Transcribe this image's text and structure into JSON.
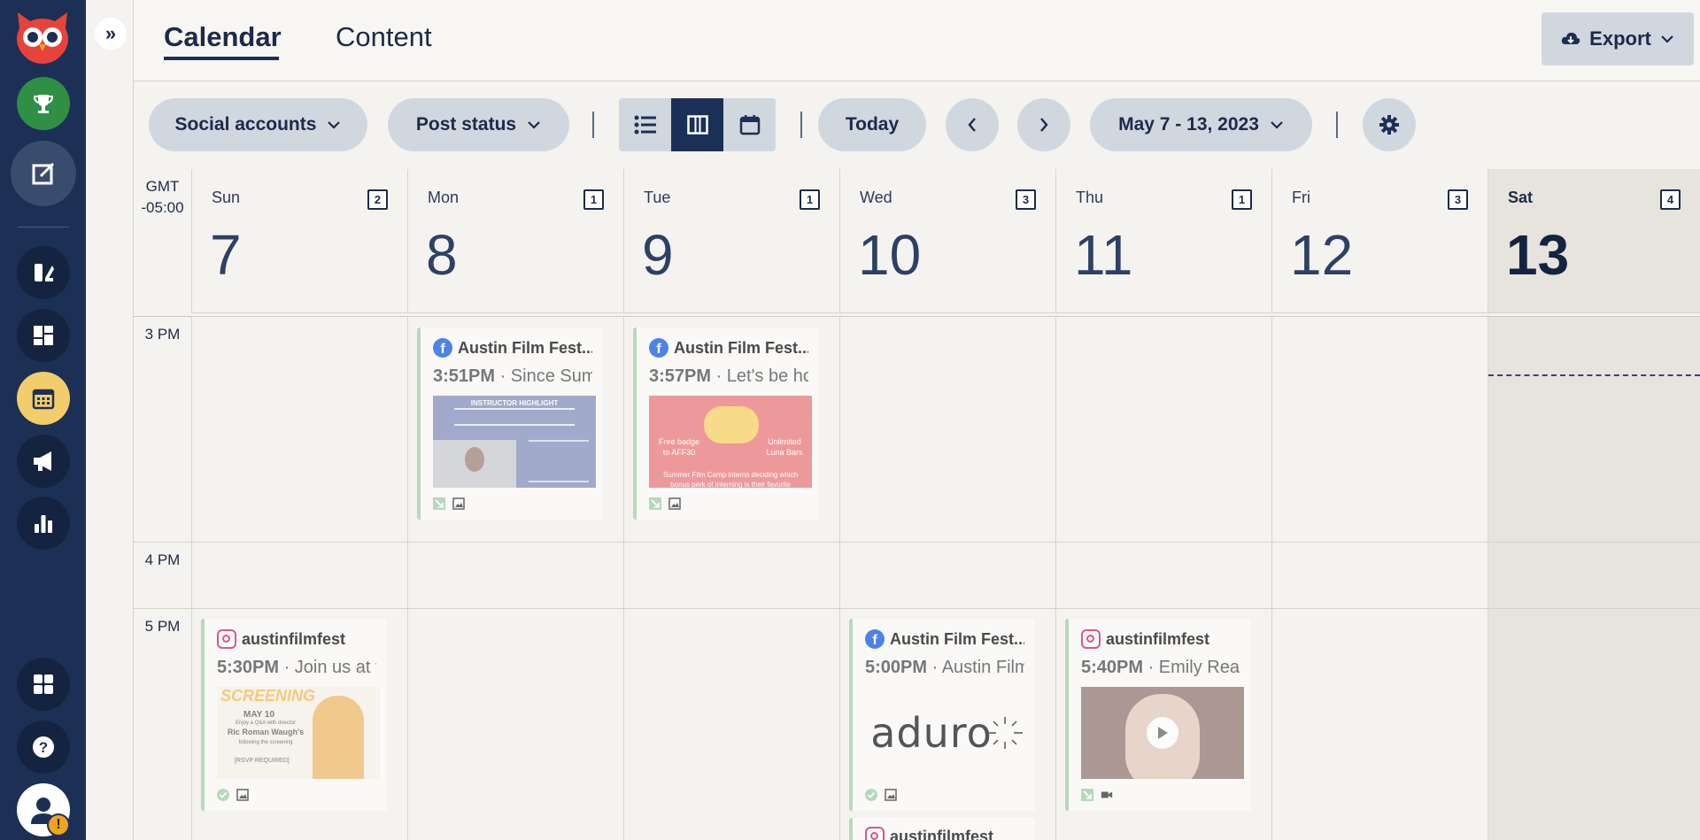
{
  "nav": {
    "items": [
      "owl-logo",
      "trophy-icon",
      "compose-icon",
      "content-icon",
      "dashboard-icon",
      "planner-icon",
      "megaphone-icon",
      "analytics-icon",
      "apps-icon",
      "help-icon",
      "profile-icon"
    ],
    "warning_badge": "!"
  },
  "tabs": {
    "calendar": "Calendar",
    "content": "Content"
  },
  "export": {
    "label": "Export"
  },
  "toolbar": {
    "social_accounts": "Social accounts",
    "post_status": "Post status",
    "today": "Today",
    "date_range": "May 7 - 13, 2023",
    "active_view": "week"
  },
  "calendar": {
    "timezone_line1": "GMT",
    "timezone_line2": "-05:00",
    "days": [
      {
        "name": "Sun",
        "num": "7",
        "count": "2"
      },
      {
        "name": "Mon",
        "num": "8",
        "count": "1"
      },
      {
        "name": "Tue",
        "num": "9",
        "count": "1"
      },
      {
        "name": "Wed",
        "num": "10",
        "count": "3"
      },
      {
        "name": "Thu",
        "num": "11",
        "count": "1"
      },
      {
        "name": "Fri",
        "num": "12",
        "count": "3"
      },
      {
        "name": "Sat",
        "num": "13",
        "count": "4"
      }
    ],
    "times": [
      "3 PM",
      "4 PM",
      "5 PM"
    ]
  },
  "posts": [
    {
      "account": "Austin Film Fest...",
      "time": "3:51PM",
      "text": "· Since Summ",
      "network": "facebook",
      "media_title": "INSTRUCTOR HIGHLIGHT"
    },
    {
      "account": "Austin Film Fest...",
      "time": "3:57PM",
      "text": "· Let's be ho",
      "network": "facebook",
      "media_left": "Free badge to AFF30",
      "media_right": "Unlimited Luna Bars",
      "media_bottom": "Summer Film Camp interns deciding which bonus perk of interning is their favorite"
    },
    {
      "account": "austinfilmfest",
      "time": "5:30PM",
      "text": "· Join us at t",
      "network": "instagram",
      "media_title": "SCREENING",
      "media_date": "MAY 10",
      "media_sub": "Enjoy a Q&A with director",
      "media_name": "Ric Roman Waugh's",
      "media_sub2": "following the screening",
      "media_rsvp": "[RSVP REQUIRED]"
    },
    {
      "account": "Austin Film Fest...",
      "time": "5:00PM",
      "text": "· Austin Film",
      "network": "facebook",
      "media_logo": "aduro"
    },
    {
      "account": "austinfilmfest",
      "time": "5:40PM",
      "text": "· Emily Reas",
      "network": "instagram"
    },
    {
      "account": "austinfilmfest",
      "network": "instagram"
    }
  ],
  "colors": {
    "nav_bg": "#1c3056",
    "accent_green": "#2f8f45",
    "accent_yellow": "#f3cd6b",
    "pill_bg": "#d1d7df",
    "facebook": "#4d83e8",
    "instagram": "#d45a8e"
  }
}
